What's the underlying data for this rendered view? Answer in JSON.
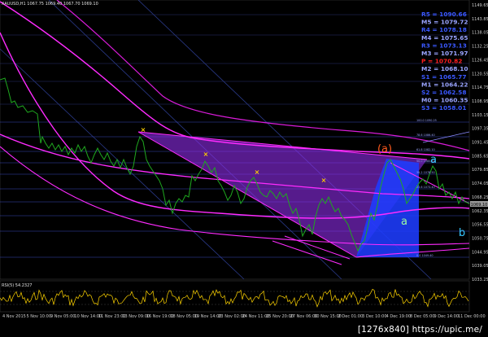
{
  "window": {
    "header_text": "XAUUSD,H1  1067.75  1069.40  1067.70  1069.10"
  },
  "colors": {
    "background": "#000000",
    "price_line": "#1fa81f",
    "envelope": "#ff2bff",
    "channel_fill": "#8a2be2",
    "support_fill": "#1e3cff",
    "grid_level": "#3a46b8",
    "oscillator": "#ffd400",
    "marker_x": "#ffd000",
    "wave_orange": "#ff5a1e",
    "wave_cyan": "#37c8ff",
    "wave_lightgreen": "#9dff9d"
  },
  "price_axis": {
    "labels": [
      "1149.65",
      "1143.85",
      "1138.05",
      "1132.25",
      "1126.45",
      "1120.55",
      "1114.75",
      "1108.95",
      "1103.15",
      "1097.35",
      "1091.45",
      "1085.65",
      "1079.85",
      "1074.05",
      "1068.25",
      "1062.35",
      "1056.55",
      "1050.75",
      "1044.95",
      "1039.05",
      "1033.25"
    ]
  },
  "current_price": {
    "label": "1069.10",
    "color": "#9a9a9a"
  },
  "pivot_levels": [
    {
      "label": "R5 = 1090.66",
      "color": "#3a58ff",
      "value": 1090.66
    },
    {
      "label": "M5 = 1079.72",
      "color": "#9aa4ff",
      "value": 1079.72
    },
    {
      "label": "R4 = 1078.18",
      "color": "#3a58ff",
      "value": 1078.18
    },
    {
      "label": "M4 = 1075.65",
      "color": "#9aa4ff",
      "value": 1075.65
    },
    {
      "label": "R3 = 1073.13",
      "color": "#3a58ff",
      "value": 1073.13
    },
    {
      "label": "M3 = 1071.97",
      "color": "#9aa4ff",
      "value": 1071.97
    },
    {
      "label": "P = 1070.82",
      "color": "#ff1e1e",
      "value": 1070.82
    },
    {
      "label": "M2 = 1068.10",
      "color": "#9aa4ff",
      "value": 1068.1
    },
    {
      "label": "S1 = 1065.77",
      "color": "#3a58ff",
      "value": 1065.77
    },
    {
      "label": "M1 = 1064.22",
      "color": "#9aa4ff",
      "value": 1064.22
    },
    {
      "label": "S2 = 1062.58",
      "color": "#3a58ff",
      "value": 1062.58
    },
    {
      "label": "M0 = 1060.35",
      "color": "#9aa4ff",
      "value": 1060.35
    },
    {
      "label": "S3 = 1058.01",
      "color": "#3a58ff",
      "value": 1058.01
    }
  ],
  "fib_labels": [
    "100.0  1090.25",
    "78.6  1086.40",
    "61.8  1082.10",
    "50.0  1080.30",
    "38.2  1078.50",
    "23.6  1073.40",
    "0.0  1049.40"
  ],
  "wave_labels": {
    "orange": "(a)",
    "cyan_upper": "a",
    "lightgreen": "a",
    "cyan_lower": "b"
  },
  "oscillator": {
    "label": "RSI(5) 54.2327"
  },
  "time_axis": {
    "labels": [
      "4 Nov 2015",
      "5 Nov 10:00",
      "9 Nov 05:00",
      "10 Nov 14:00",
      "11 Nov 23:00",
      "13 Nov 09:00",
      "16 Nov 19:00",
      "18 Nov 05:00",
      "19 Nov 14:00",
      "23 Nov 02:00",
      "24 Nov 11:00",
      "25 Nov 20:00",
      "27 Nov 06:00",
      "30 Nov 15:00",
      "2 Dec 01:00",
      "3 Dec 10:00",
      "4 Dec 19:00",
      "8 Dec 05:00",
      "9 Dec 14:00",
      "11 Dec 00:00"
    ]
  },
  "watermark": "[1276x840] https://upic.me/"
}
